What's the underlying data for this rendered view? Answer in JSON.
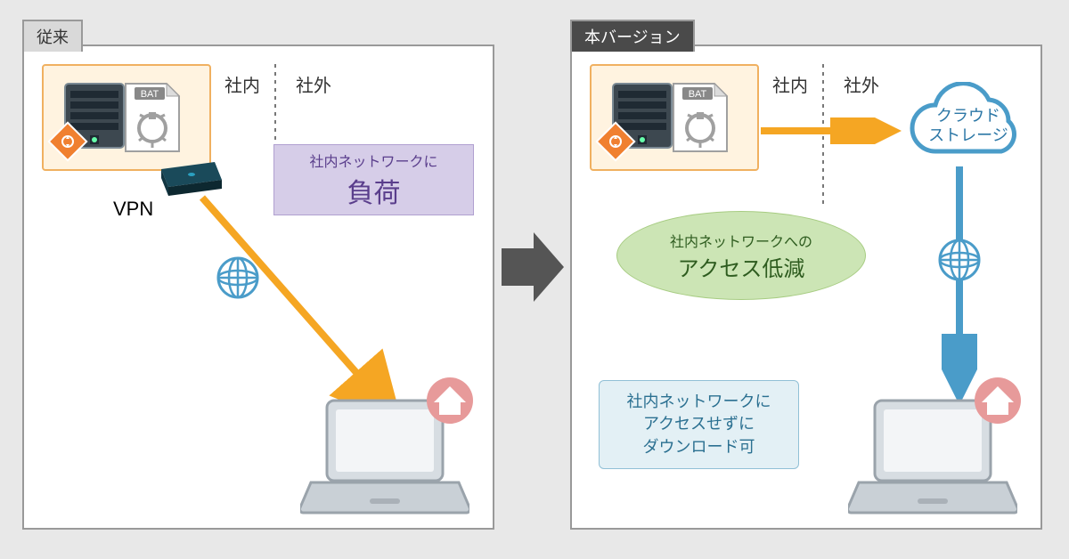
{
  "panels": {
    "left": {
      "tab": "従来",
      "loc_in": "社内",
      "loc_out": "社外",
      "vpn": "VPN",
      "calloutPurple_l1": "社内ネットワークに",
      "calloutPurple_l2": "負荷"
    },
    "right": {
      "tab": "本バージョン",
      "loc_in": "社内",
      "loc_out": "社外",
      "cloud_l1": "クラウド",
      "cloud_l2": "ストレージ",
      "ellipse_l1": "社内ネットワークへの",
      "ellipse_l2": "アクセス低減",
      "calloutBlue_l1": "社内ネットワークに",
      "calloutBlue_l2": "アクセスせずに",
      "calloutBlue_l3": "ダウンロード可"
    }
  },
  "icons": {
    "server_bat": "BAT"
  },
  "colors": {
    "arrow_orange": "#f5a623",
    "arrow_blue": "#4a9cc9",
    "tab_dark": "#4a4a4a"
  }
}
